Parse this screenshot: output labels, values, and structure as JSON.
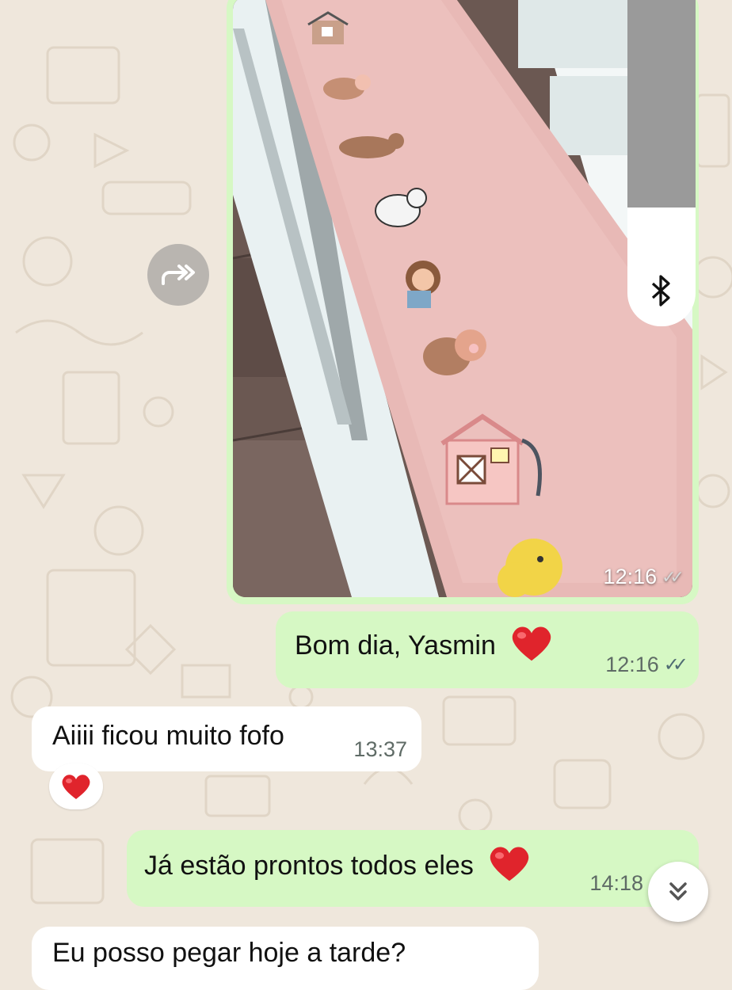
{
  "photo_message": {
    "time": "12:16",
    "status_icon": "double-check-icon"
  },
  "messages": [
    {
      "text": "Bom dia, Yasmin",
      "emoji": "red-heart",
      "time": "12:16",
      "direction": "outgoing",
      "status_icon": "double-check-icon"
    },
    {
      "text": "Aiiii ficou muito fofo",
      "time": "13:37",
      "direction": "incoming",
      "reaction": "red-heart"
    },
    {
      "text": "Já estão prontos todos eles",
      "emoji": "red-heart",
      "time": "14:18",
      "direction": "outgoing"
    },
    {
      "text": "Eu posso pegar hoje a tarde?",
      "direction": "incoming"
    }
  ],
  "icons": {
    "forward": "forward-icon",
    "bluetooth": "bluetooth-icon",
    "scroll_down": "double-chevron-down-icon"
  },
  "colors": {
    "outgoing_bubble": "#d6f8c4",
    "incoming_bubble": "#ffffff",
    "chat_background": "#efe7dc",
    "heart": "#e0242c"
  }
}
